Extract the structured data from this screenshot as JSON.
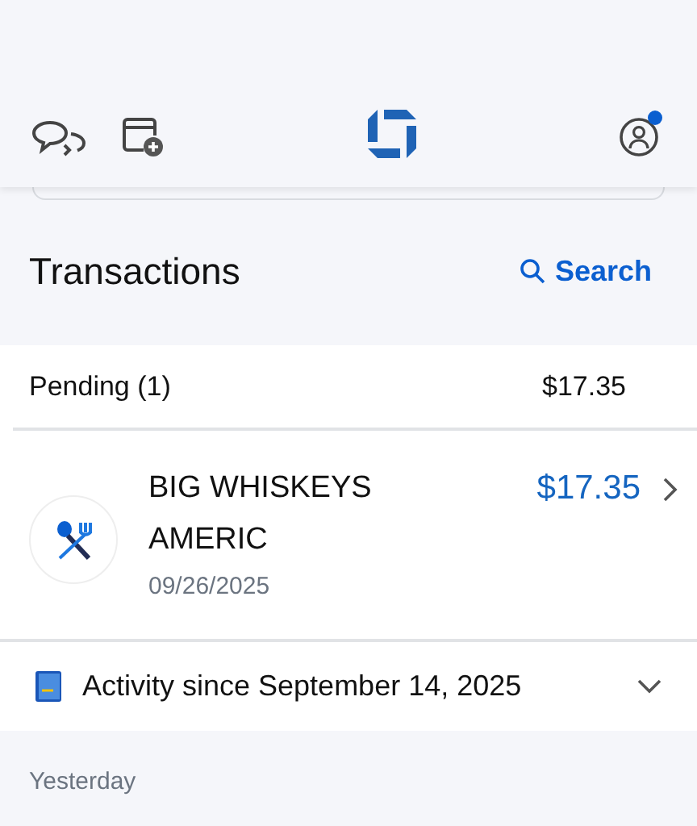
{
  "heading": "Transactions",
  "search": {
    "label": "Search"
  },
  "pending": {
    "label": "Pending (1)",
    "total": "$17.35"
  },
  "transactions": [
    {
      "merchant": "BIG WHISKEYS AMERIC",
      "date": "09/26/2025",
      "amount": "$17.35"
    }
  ],
  "activity": {
    "label": "Activity since September 14, 2025"
  },
  "section": "Yesterday"
}
